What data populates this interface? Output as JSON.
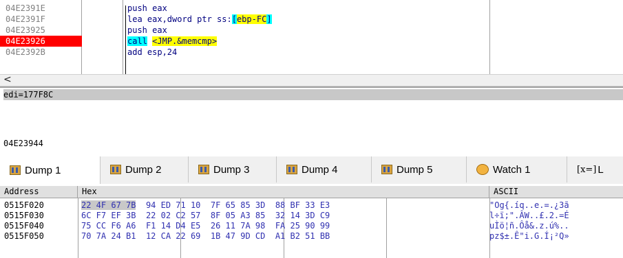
{
  "disasm": {
    "rows": [
      {
        "addr": "04E2391E",
        "instr": "push eax"
      },
      {
        "addr": "04E2391F",
        "instr_pre": "lea eax,dword ptr ss:",
        "instr_br_open": "[",
        "instr_hl": "ebp-FC",
        "instr_br_close": "]"
      },
      {
        "addr": "04E23925",
        "instr": "push eax"
      },
      {
        "addr": "04E23926",
        "instr_call": "call",
        "instr_target": "<JMP.&memcmp>"
      },
      {
        "addr": "04E2392B",
        "instr": "add esp,24"
      }
    ]
  },
  "scroll": {
    "left_arrow": "<"
  },
  "info": {
    "line1": "edi=177F8C",
    "address": "04E23944"
  },
  "tabs": [
    {
      "label": "Dump 1",
      "icon": "dump-icon"
    },
    {
      "label": "Dump 2",
      "icon": "dump-icon"
    },
    {
      "label": "Dump 3",
      "icon": "dump-icon"
    },
    {
      "label": "Dump 4",
      "icon": "dump-icon"
    },
    {
      "label": "Dump 5",
      "icon": "dump-icon"
    },
    {
      "label": "Watch 1",
      "icon": "watch-icon"
    },
    {
      "label": "L",
      "icon": "locals-icon",
      "icon_text": "[x=]"
    }
  ],
  "dump": {
    "headers": {
      "address": "Address",
      "hex": "Hex",
      "ascii": "ASCII"
    },
    "rows": [
      {
        "addr": "0515F020",
        "g1": "22 4F 67 7B",
        "g2": "94 ED 71 10",
        "g3": "7F 65 85 3D",
        "g4": "88 BF 33 E3",
        "ascii": "\"Og{.íq..e.=.¿3ã"
      },
      {
        "addr": "0515F030",
        "g1": "6C F7 EF 3B",
        "g2": "22 02 C2 57",
        "g3": "8F 05 A3 85",
        "g4": "32 14 3D C9",
        "ascii": "l÷ï;\".ÂW..£.2.=É"
      },
      {
        "addr": "0515F040",
        "g1": "75 CC F6 A6",
        "g2": "F1 14 D4 E5",
        "g3": "26 11 7A 98",
        "g4": "FA 25 90 99",
        "ascii": "uÌö¦ñ.Ôå&.z.ú%.."
      },
      {
        "addr": "0515F050",
        "g1": "70 7A 24 B1",
        "g2": "12 CA 22 69",
        "g3": "1B 47 9D CD",
        "g4": "A1 B2 51 BB",
        "ascii": "pz$±.Ê\"i.G.Í¡²Q»"
      }
    ]
  }
}
